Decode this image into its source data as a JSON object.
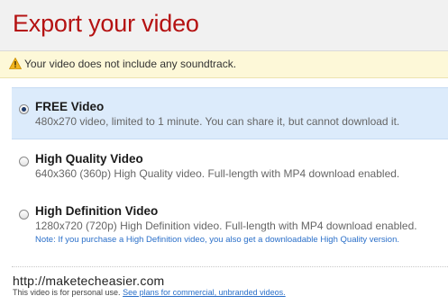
{
  "header": {
    "title": "Export your video"
  },
  "warning": {
    "icon": "warning-icon",
    "text": "Your video does not include any soundtrack."
  },
  "options": [
    {
      "title": "FREE Video",
      "description": "480x270 video, limited to 1 minute. You can share it, but cannot download it.",
      "selected": true
    },
    {
      "title": "High Quality Video",
      "description": "640x360 (360p) High Quality video. Full-length with MP4 download enabled.",
      "selected": false
    },
    {
      "title": "High Definition Video",
      "description": "1280x720 (720p) High Definition video. Full-length with MP4 download enabled.",
      "note": "Note: If you purchase a High Definition video, you also get a downloadable High Quality version.",
      "selected": false
    }
  ],
  "watermark": {
    "url": "http://maketecheasier.com"
  },
  "footer": {
    "text": "This video is for personal use.",
    "link": "See plans for commercial, unbranded videos."
  },
  "colors": {
    "title": "#b51212",
    "selected_bg": "#dcebfb",
    "warning_bg": "#fdf8d8",
    "link": "#2a6fc9"
  }
}
